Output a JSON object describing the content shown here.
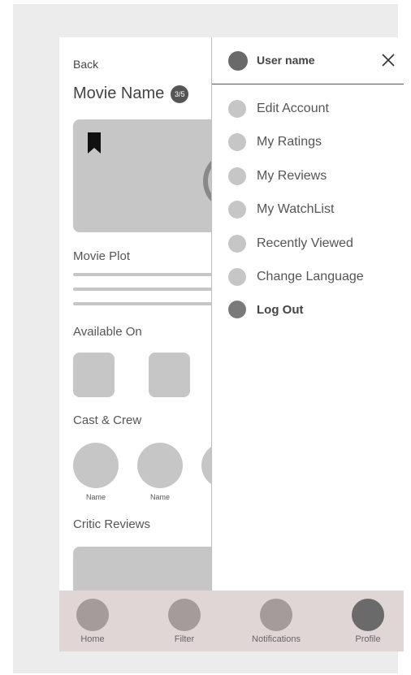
{
  "page": {
    "back_label": "Back",
    "title": "Movie Name",
    "rating_badge": "3/5",
    "sections": {
      "plot": "Movie Plot",
      "available": "Available On",
      "cast": "Cast & Crew",
      "reviews": "Critic Reviews"
    },
    "cast": [
      {
        "name": "Name"
      },
      {
        "name": "Name"
      }
    ]
  },
  "drawer": {
    "user_name": "User name",
    "close_icon": "close-icon",
    "items": [
      {
        "label": "Edit Account"
      },
      {
        "label": "My Ratings"
      },
      {
        "label": "My Reviews"
      },
      {
        "label": "My WatchList"
      },
      {
        "label": "Recently Viewed"
      },
      {
        "label": "Change Language"
      },
      {
        "label": "Log Out"
      }
    ]
  },
  "nav": {
    "items": [
      {
        "label": "Home"
      },
      {
        "label": "Filter"
      },
      {
        "label": "Notifications"
      },
      {
        "label": "Profile"
      }
    ],
    "active": "Profile"
  },
  "colors": {
    "background": "#ececec",
    "placeholder": "#c6c6c6",
    "nav_bar": "#e0d6d6",
    "nav_icon": "#a59b9b",
    "active_icon": "#6a6a6a"
  }
}
